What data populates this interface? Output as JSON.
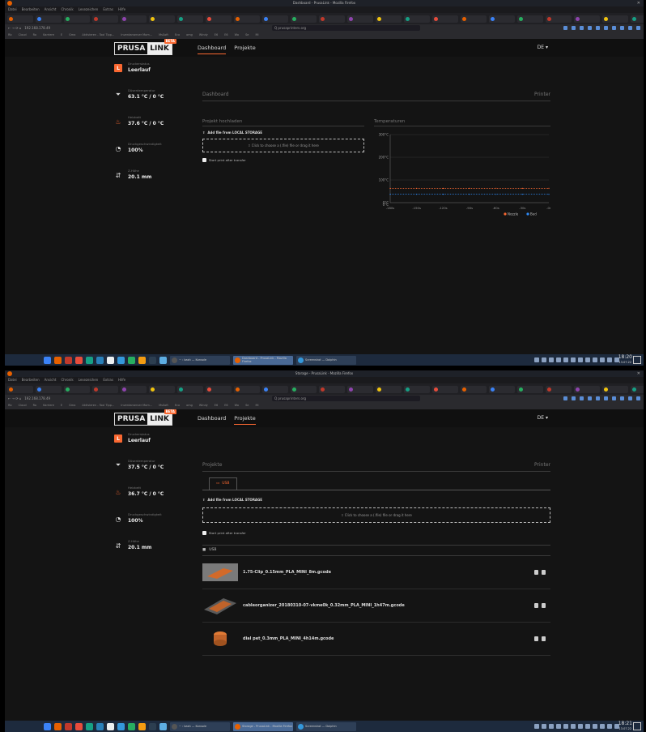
{
  "browser": {
    "menu": [
      "Datei",
      "Bearbeiten",
      "Ansicht",
      "Chronik",
      "Lesezeichen",
      "Extras",
      "Hilfe"
    ],
    "address": "192.168.178.49",
    "search_hint": "Q prusaprinters.org",
    "bookmarks": [
      "Rb",
      "Cloud",
      "Ro",
      "Karriere",
      "E",
      "Gma",
      "Aktivieren - Tool Tipp...",
      "Inventarserver Mom...",
      "MsSoft",
      "Eco",
      "omg",
      "Windy",
      "E6",
      "E6",
      "Wo",
      "Se",
      "Ml"
    ],
    "tab_count": 28
  },
  "app": {
    "logo_prusa": "PRUSA",
    "logo_link": "LINK",
    "logo_badge": "BETA",
    "nav_dashboard": "Dashboard",
    "nav_projects": "Projekte",
    "lang": "DE ▾"
  },
  "shot1": {
    "window_title": "Dashboard - PrusaLink - Mozilla Firefox",
    "sidebar": [
      {
        "label": "Druckerstatus",
        "value": "Leerlauf"
      },
      {
        "label": "Düsentemperatur",
        "value": "63.1 °C / 0 °C"
      },
      {
        "label": "Heizbett",
        "value": "37.6 °C / 0 °C"
      },
      {
        "label": "Druckgeschwindigkeit",
        "value": "100%"
      },
      {
        "label": "Z-Höhe",
        "value": "20.1 mm"
      }
    ],
    "section_title": "Dashboard",
    "section_right": "Printer",
    "upload_title": "Projekt hochladen",
    "add_file": "Add file from LOCAL STORAGE",
    "drop_text": "Click to choose a (.file) file or drag it here",
    "start_print": "Start print after transfer",
    "temp_title": "Temperaturen",
    "taskbar_win1": "~ : bash — Konsole",
    "taskbar_win2": "Dashboard - PrusaLink - Mozilla Firefox",
    "taskbar_win3": "Screenshot — Dolphin",
    "clock": "18:20",
    "date": "13.07.22"
  },
  "shot2": {
    "window_title": "Storage - PrusaLink - Mozilla Firefox",
    "sidebar": [
      {
        "label": "Druckerstatus",
        "value": "Leerlauf"
      },
      {
        "label": "Düsentemperatur",
        "value": "37.5 °C / 0 °C"
      },
      {
        "label": "Heizbett",
        "value": "36.7 °C / 0 °C"
      },
      {
        "label": "Druckgeschwindigkeit",
        "value": "100%"
      },
      {
        "label": "Z-Höhe",
        "value": "20.1 mm"
      }
    ],
    "section_title": "Projekte",
    "section_right": "Printer",
    "storage_tab": "USB",
    "add_file": "Add file from LOCAL STORAGE",
    "drop_text": "Click to choose a (.file) file or drag it here",
    "start_print": "Start print after transfer",
    "folder": "USB",
    "files": [
      "1.75-Clip_0.15mm_PLA_MINI_8m.gcode",
      "cableorganizer_20180310-07-vkme0k_0.32mm_PLA_MINI_1h47m.gcode",
      "dial pet_0.3mm_PLA_MINI_4h14m.gcode"
    ],
    "taskbar_win1": "~ : bash — Konsole",
    "taskbar_win2": "Storage - PrusaLink - Mozilla Firefox",
    "taskbar_win3": "Screenshot — Dolphin",
    "clock": "18:21",
    "date": "13.07.22"
  },
  "chart_data": {
    "type": "line",
    "title": "",
    "y_ticks": [
      "300°C",
      "200°C",
      "100°C",
      "0°C",
      "0°C"
    ],
    "x_ticks": [
      "-180s",
      "-150s",
      "-120s",
      "-90s",
      "-60s",
      "-30s",
      "-0s"
    ],
    "ylim": [
      0,
      300
    ],
    "series": [
      {
        "name": "Nozzle",
        "color": "#fa6831",
        "x": [
          -180,
          -150,
          -120,
          -90,
          -60,
          -30,
          0
        ],
        "values": [
          63,
          63,
          63,
          63,
          63,
          63,
          63
        ]
      },
      {
        "name": "Bed",
        "color": "#2f8af5",
        "x": [
          -180,
          -150,
          -120,
          -90,
          -60,
          -30,
          0
        ],
        "values": [
          37,
          37,
          37,
          37,
          37,
          37,
          37
        ]
      }
    ],
    "legend": "bottom-right",
    "grid": true
  }
}
